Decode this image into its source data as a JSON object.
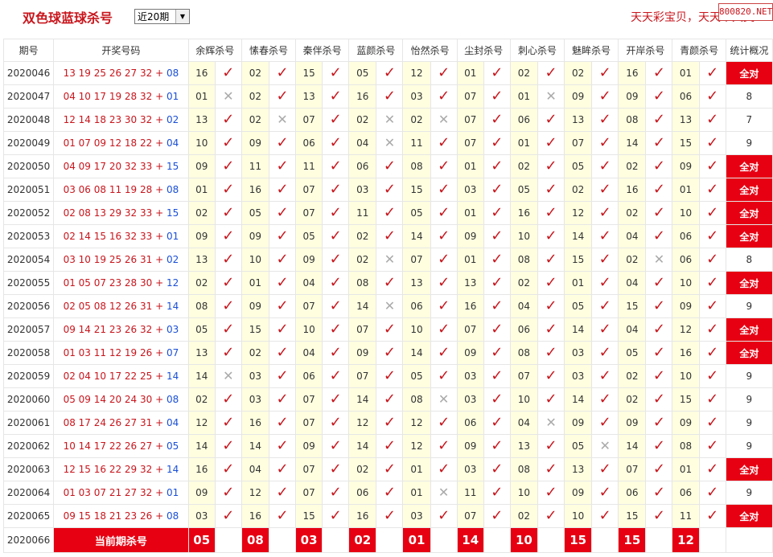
{
  "header": {
    "title": "双色球蓝球杀号",
    "range_select": "近20期",
    "slogan": "天天彩宝贝，天天中大奖!",
    "badge": "800820.NET"
  },
  "table": {
    "columns": [
      "期号",
      "开奖号码",
      "余辉杀号",
      "愫春杀号",
      "秦伴杀号",
      "蓝颜杀号",
      "怡然杀号",
      "尘封杀号",
      "刺心杀号",
      "魅眸杀号",
      "开岸杀号",
      "青颜杀号",
      "统计概况"
    ],
    "all_correct_label": "全对",
    "rows": [
      {
        "period": "2020046",
        "red": "13 19 25 26 27 32",
        "blue": "08",
        "kills": [
          "16",
          "02",
          "15",
          "05",
          "12",
          "01",
          "02",
          "02",
          "16",
          "01"
        ],
        "hits": [
          1,
          1,
          1,
          1,
          1,
          1,
          1,
          1,
          1,
          1
        ],
        "stat": "全对"
      },
      {
        "period": "2020047",
        "red": "04 10 17 19 28 32",
        "blue": "01",
        "kills": [
          "01",
          "02",
          "13",
          "16",
          "03",
          "07",
          "01",
          "09",
          "09",
          "06"
        ],
        "hits": [
          0,
          1,
          1,
          1,
          1,
          1,
          0,
          1,
          1,
          1
        ],
        "stat": "8"
      },
      {
        "period": "2020048",
        "red": "12 14 18 23 30 32",
        "blue": "02",
        "kills": [
          "13",
          "02",
          "07",
          "02",
          "02",
          "07",
          "06",
          "13",
          "08",
          "13"
        ],
        "hits": [
          1,
          0,
          1,
          0,
          0,
          1,
          1,
          1,
          1,
          1
        ],
        "stat": "7"
      },
      {
        "period": "2020049",
        "red": "01 07 09 12 18 22",
        "blue": "04",
        "kills": [
          "10",
          "09",
          "06",
          "04",
          "11",
          "07",
          "01",
          "07",
          "14",
          "15"
        ],
        "hits": [
          1,
          1,
          1,
          0,
          1,
          1,
          1,
          1,
          1,
          1
        ],
        "stat": "9"
      },
      {
        "period": "2020050",
        "red": "04 09 17 20 32 33",
        "blue": "15",
        "kills": [
          "09",
          "11",
          "11",
          "06",
          "08",
          "01",
          "02",
          "05",
          "02",
          "09"
        ],
        "hits": [
          1,
          1,
          1,
          1,
          1,
          1,
          1,
          1,
          1,
          1
        ],
        "stat": "全对"
      },
      {
        "period": "2020051",
        "red": "03 06 08 11 19 28",
        "blue": "08",
        "kills": [
          "01",
          "16",
          "07",
          "03",
          "15",
          "03",
          "05",
          "02",
          "16",
          "01"
        ],
        "hits": [
          1,
          1,
          1,
          1,
          1,
          1,
          1,
          1,
          1,
          1
        ],
        "stat": "全对"
      },
      {
        "period": "2020052",
        "red": "02 08 13 29 32 33",
        "blue": "15",
        "kills": [
          "02",
          "05",
          "07",
          "11",
          "05",
          "01",
          "16",
          "12",
          "02",
          "10"
        ],
        "hits": [
          1,
          1,
          1,
          1,
          1,
          1,
          1,
          1,
          1,
          1
        ],
        "stat": "全对"
      },
      {
        "period": "2020053",
        "red": "02 14 15 16 32 33",
        "blue": "01",
        "kills": [
          "09",
          "09",
          "05",
          "02",
          "14",
          "09",
          "10",
          "14",
          "04",
          "06"
        ],
        "hits": [
          1,
          1,
          1,
          1,
          1,
          1,
          1,
          1,
          1,
          1
        ],
        "stat": "全对"
      },
      {
        "period": "2020054",
        "red": "03 10 19 25 26 31",
        "blue": "02",
        "kills": [
          "13",
          "10",
          "09",
          "02",
          "07",
          "01",
          "08",
          "15",
          "02",
          "06"
        ],
        "hits": [
          1,
          1,
          1,
          0,
          1,
          1,
          1,
          1,
          0,
          1
        ],
        "stat": "8"
      },
      {
        "period": "2020055",
        "red": "01 05 07 23 28 30",
        "blue": "12",
        "kills": [
          "02",
          "01",
          "04",
          "08",
          "13",
          "13",
          "02",
          "01",
          "04",
          "10"
        ],
        "hits": [
          1,
          1,
          1,
          1,
          1,
          1,
          1,
          1,
          1,
          1
        ],
        "stat": "全对"
      },
      {
        "period": "2020056",
        "red": "02 05 08 12 26 31",
        "blue": "14",
        "kills": [
          "08",
          "09",
          "07",
          "14",
          "06",
          "16",
          "04",
          "05",
          "15",
          "09"
        ],
        "hits": [
          1,
          1,
          1,
          0,
          1,
          1,
          1,
          1,
          1,
          1
        ],
        "stat": "9"
      },
      {
        "period": "2020057",
        "red": "09 14 21 23 26 32",
        "blue": "03",
        "kills": [
          "05",
          "15",
          "10",
          "07",
          "10",
          "07",
          "06",
          "14",
          "04",
          "12"
        ],
        "hits": [
          1,
          1,
          1,
          1,
          1,
          1,
          1,
          1,
          1,
          1
        ],
        "stat": "全对"
      },
      {
        "period": "2020058",
        "red": "01 03 11 12 19 26",
        "blue": "07",
        "kills": [
          "13",
          "02",
          "04",
          "09",
          "14",
          "09",
          "08",
          "03",
          "05",
          "16"
        ],
        "hits": [
          1,
          1,
          1,
          1,
          1,
          1,
          1,
          1,
          1,
          1
        ],
        "stat": "全对"
      },
      {
        "period": "2020059",
        "red": "02 04 10 17 22 25",
        "blue": "14",
        "kills": [
          "14",
          "03",
          "06",
          "07",
          "05",
          "03",
          "07",
          "03",
          "02",
          "10"
        ],
        "hits": [
          0,
          1,
          1,
          1,
          1,
          1,
          1,
          1,
          1,
          1
        ],
        "stat": "9"
      },
      {
        "period": "2020060",
        "red": "05 09 14 20 24 30",
        "blue": "08",
        "kills": [
          "02",
          "03",
          "07",
          "14",
          "08",
          "03",
          "10",
          "14",
          "02",
          "15"
        ],
        "hits": [
          1,
          1,
          1,
          1,
          0,
          1,
          1,
          1,
          1,
          1
        ],
        "stat": "9"
      },
      {
        "period": "2020061",
        "red": "08 17 24 26 27 31",
        "blue": "04",
        "kills": [
          "12",
          "16",
          "07",
          "12",
          "12",
          "06",
          "04",
          "09",
          "09",
          "09"
        ],
        "hits": [
          1,
          1,
          1,
          1,
          1,
          1,
          0,
          1,
          1,
          1
        ],
        "stat": "9"
      },
      {
        "period": "2020062",
        "red": "10 14 17 22 26 27",
        "blue": "05",
        "kills": [
          "14",
          "14",
          "09",
          "14",
          "12",
          "09",
          "13",
          "05",
          "14",
          "08"
        ],
        "hits": [
          1,
          1,
          1,
          1,
          1,
          1,
          1,
          0,
          1,
          1
        ],
        "stat": "9"
      },
      {
        "period": "2020063",
        "red": "12 15 16 22 29 32",
        "blue": "14",
        "kills": [
          "16",
          "04",
          "07",
          "02",
          "01",
          "03",
          "08",
          "13",
          "07",
          "01"
        ],
        "hits": [
          1,
          1,
          1,
          1,
          1,
          1,
          1,
          1,
          1,
          1
        ],
        "stat": "全对"
      },
      {
        "period": "2020064",
        "red": "01 03 07 21 27 32",
        "blue": "01",
        "kills": [
          "09",
          "12",
          "07",
          "06",
          "01",
          "11",
          "10",
          "09",
          "06",
          "06"
        ],
        "hits": [
          1,
          1,
          1,
          1,
          0,
          1,
          1,
          1,
          1,
          1
        ],
        "stat": "9"
      },
      {
        "period": "2020065",
        "red": "09 15 18 21 23 26",
        "blue": "08",
        "kills": [
          "03",
          "16",
          "15",
          "16",
          "03",
          "07",
          "02",
          "10",
          "15",
          "11"
        ],
        "hits": [
          1,
          1,
          1,
          1,
          1,
          1,
          1,
          1,
          1,
          1
        ],
        "stat": "全对"
      }
    ],
    "current": {
      "period": "2020066",
      "label": "当前期杀号",
      "kills": [
        "05",
        "08",
        "03",
        "02",
        "01",
        "14",
        "10",
        "15",
        "15",
        "12"
      ]
    }
  },
  "icons": {
    "hit": "check-icon",
    "miss": "cross-icon"
  },
  "colors": {
    "red": "#c8161d",
    "accent": "#e60012",
    "blue": "#1a4fd6",
    "highlight": "#ffffe0"
  }
}
